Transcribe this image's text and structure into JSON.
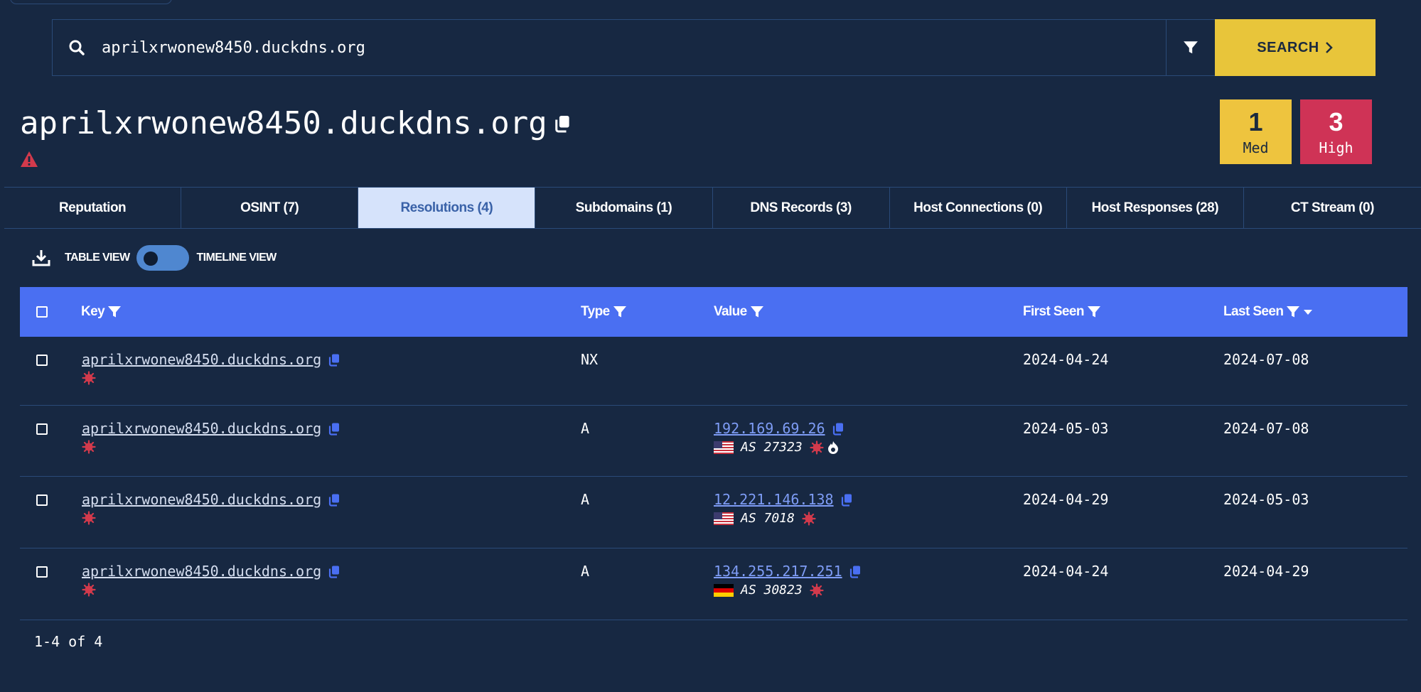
{
  "search": {
    "value": "aprilxrwonew8450.duckdns.org",
    "button_label": "SEARCH"
  },
  "title": "aprilxrwonew8450.duckdns.org",
  "severity": {
    "med": {
      "count": "1",
      "label": "Med"
    },
    "high": {
      "count": "3",
      "label": "High"
    }
  },
  "tabs": [
    {
      "label": "Reputation"
    },
    {
      "label": "OSINT (7)"
    },
    {
      "label": "Resolutions (4)"
    },
    {
      "label": "Subdomains (1)"
    },
    {
      "label": "DNS Records (3)"
    },
    {
      "label": "Host Connections (0)"
    },
    {
      "label": "Host Responses (28)"
    },
    {
      "label": "CT Stream (0)"
    }
  ],
  "active_tab": "Resolutions (4)",
  "view": {
    "table_label": "TABLE VIEW",
    "timeline_label": "TIMELINE VIEW"
  },
  "table": {
    "headers": {
      "key": "Key",
      "type": "Type",
      "value": "Value",
      "first_seen": "First Seen",
      "last_seen": "Last Seen"
    },
    "rows": [
      {
        "key": "aprilxrwonew8450.duckdns.org",
        "type": "NX",
        "value": "",
        "asn": "",
        "flag": "",
        "first_seen": "2024-04-24",
        "last_seen": "2024-07-08"
      },
      {
        "key": "aprilxrwonew8450.duckdns.org",
        "type": "A",
        "value": "192.169.69.26",
        "asn": "AS 27323",
        "flag": "us",
        "first_seen": "2024-05-03",
        "last_seen": "2024-07-08"
      },
      {
        "key": "aprilxrwonew8450.duckdns.org",
        "type": "A",
        "value": "12.221.146.138",
        "asn": "AS 7018",
        "flag": "us",
        "first_seen": "2024-04-29",
        "last_seen": "2024-05-03"
      },
      {
        "key": "aprilxrwonew8450.duckdns.org",
        "type": "A",
        "value": "134.255.217.251",
        "asn": "AS 30823",
        "flag": "de",
        "first_seen": "2024-04-24",
        "last_seen": "2024-04-29"
      }
    ]
  },
  "pagination": "1-4 of 4",
  "colors": {
    "background": "#172842",
    "accent": "#4a6ff2",
    "search_button": "#e8c53a",
    "med": "#eec43e",
    "high": "#cf3356",
    "malicious": "#d33a4c"
  }
}
